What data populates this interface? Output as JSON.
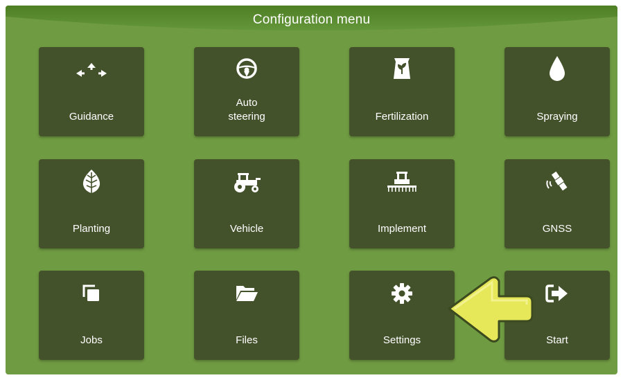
{
  "header": {
    "title": "Configuration menu"
  },
  "tiles": [
    {
      "label_line1": "",
      "label_line2": "Guidance",
      "icon": "guidance-arrows-icon"
    },
    {
      "label_line1": "Auto",
      "label_line2": "steering",
      "icon": "steering-wheel-icon"
    },
    {
      "label_line1": "",
      "label_line2": "Fertilization",
      "icon": "fertilizer-bag-icon"
    },
    {
      "label_line1": "",
      "label_line2": "Spraying",
      "icon": "droplet-icon"
    },
    {
      "label_line1": "",
      "label_line2": "Planting",
      "icon": "leaf-icon"
    },
    {
      "label_line1": "",
      "label_line2": "Vehicle",
      "icon": "tractor-icon"
    },
    {
      "label_line1": "",
      "label_line2": "Implement",
      "icon": "implement-icon"
    },
    {
      "label_line1": "",
      "label_line2": "GNSS",
      "icon": "satellite-icon"
    },
    {
      "label_line1": "",
      "label_line2": "Jobs",
      "icon": "jobs-icon"
    },
    {
      "label_line1": "",
      "label_line2": "Files",
      "icon": "folder-icon"
    },
    {
      "label_line1": "",
      "label_line2": "Settings",
      "icon": "gear-icon"
    },
    {
      "label_line1": "",
      "label_line2": "Start",
      "icon": "exit-icon"
    }
  ],
  "overlay": {
    "icon": "yellow-pointer-arrow-icon",
    "color": "#e6e85a"
  },
  "colors": {
    "background": "#6f9b42",
    "tile": "#44522c",
    "header": "#5a8a2e"
  }
}
